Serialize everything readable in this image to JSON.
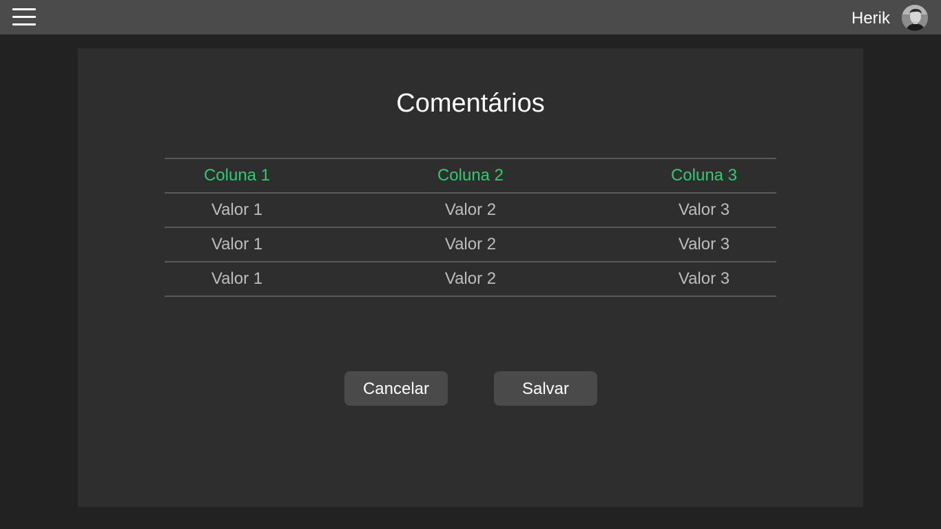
{
  "header": {
    "menu_icon": "hamburger-menu-icon",
    "username": "Herik",
    "avatar_icon": "user-avatar"
  },
  "main": {
    "title": "Comentários",
    "table": {
      "headers": [
        "Coluna 1",
        "Coluna 2",
        "Coluna 3"
      ],
      "rows": [
        [
          "Valor 1",
          "Valor 2",
          "Valor 3"
        ],
        [
          "Valor 1",
          "Valor 2",
          "Valor 3"
        ],
        [
          "Valor 1",
          "Valor 2",
          "Valor 3"
        ]
      ]
    },
    "buttons": {
      "cancel_label": "Cancelar",
      "save_label": "Salvar"
    }
  },
  "colors": {
    "header_bg": "#4b4b4b",
    "page_bg": "#222222",
    "card_bg": "#2e2e2e",
    "accent_green": "#2ecc71",
    "button_bg": "#4a4a4a"
  }
}
